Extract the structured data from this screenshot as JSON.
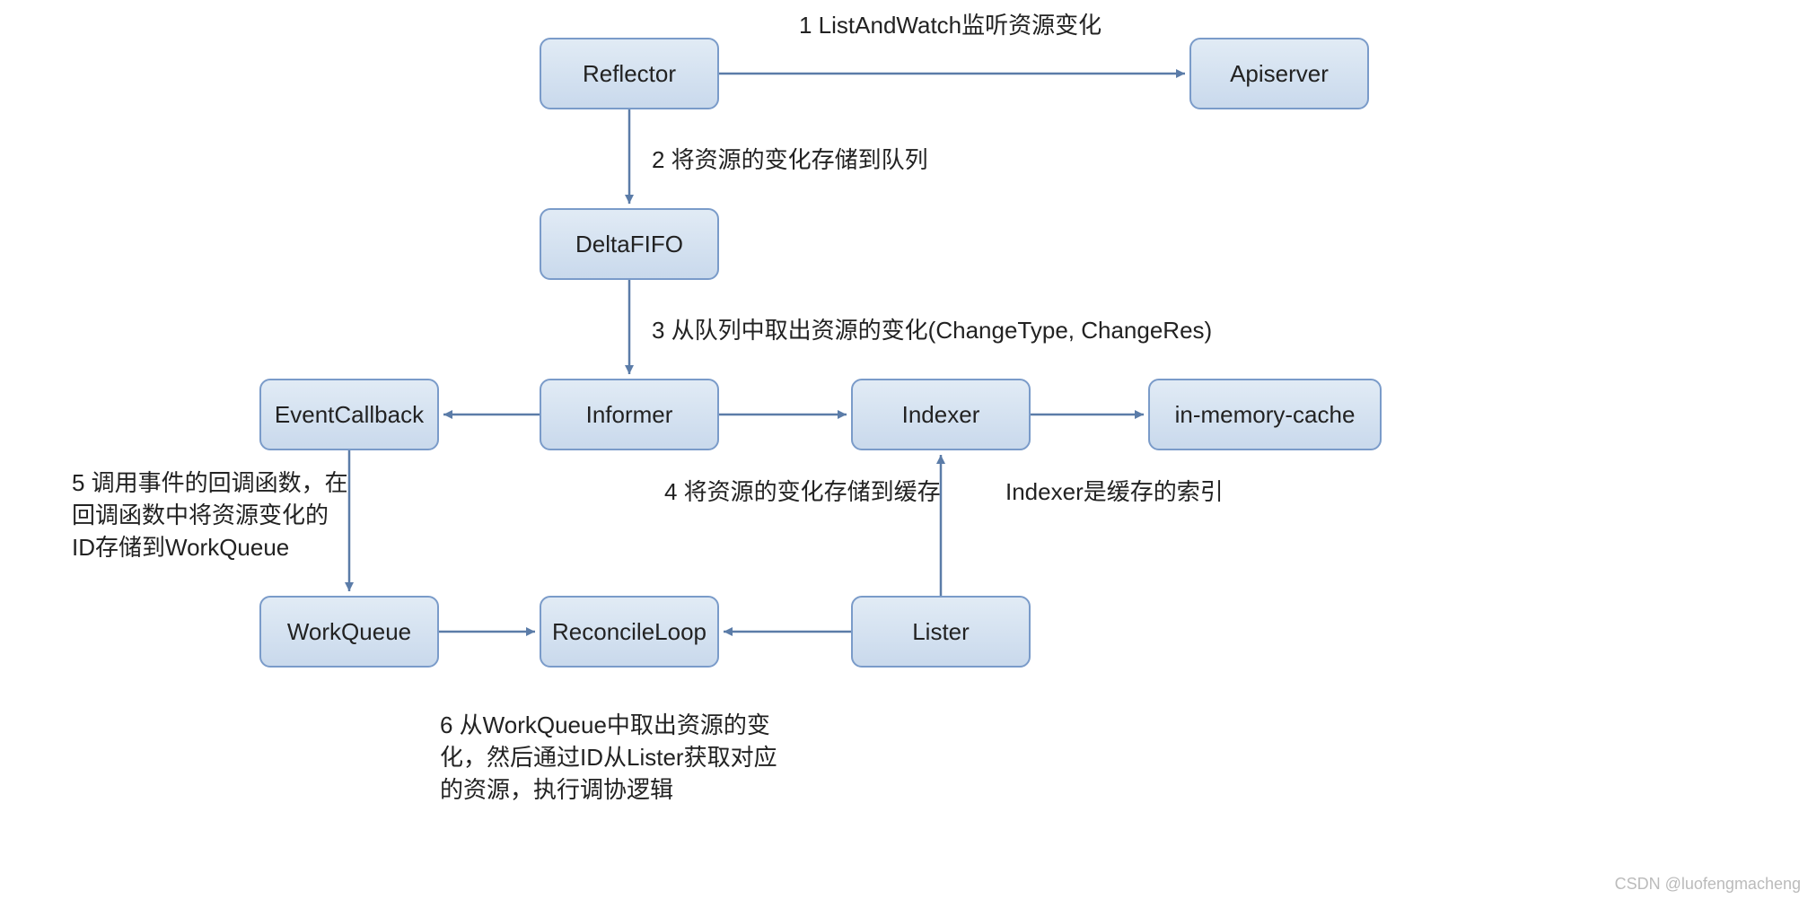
{
  "nodes": {
    "reflector": "Reflector",
    "apiserver": "Apiserver",
    "deltafifo": "DeltaFIFO",
    "informer": "Informer",
    "eventcallback": "EventCallback",
    "indexer": "Indexer",
    "inmemorycache": "in-memory-cache",
    "workqueue": "WorkQueue",
    "reconcileloop": "ReconcileLoop",
    "lister": "Lister"
  },
  "labels": {
    "l1": "1 ListAndWatch监听资源变化",
    "l2": "2 将资源的变化存储到队列",
    "l3": "3 从队列中取出资源的变化(ChangeType, ChangeRes)",
    "l4": "4 将资源的变化存储到缓存",
    "l5a": "5 调用事件的回调函数，在",
    "l5b": "回调函数中将资源变化的",
    "l5c": "ID存储到WorkQueue",
    "l6a": "6 从WorkQueue中取出资源的变",
    "l6b": "化，然后通过ID从Lister获取对应",
    "l6c": "的资源，执行调协逻辑",
    "lindexer": "Indexer是缓存的索引"
  },
  "watermark": "CSDN @luofengmacheng"
}
